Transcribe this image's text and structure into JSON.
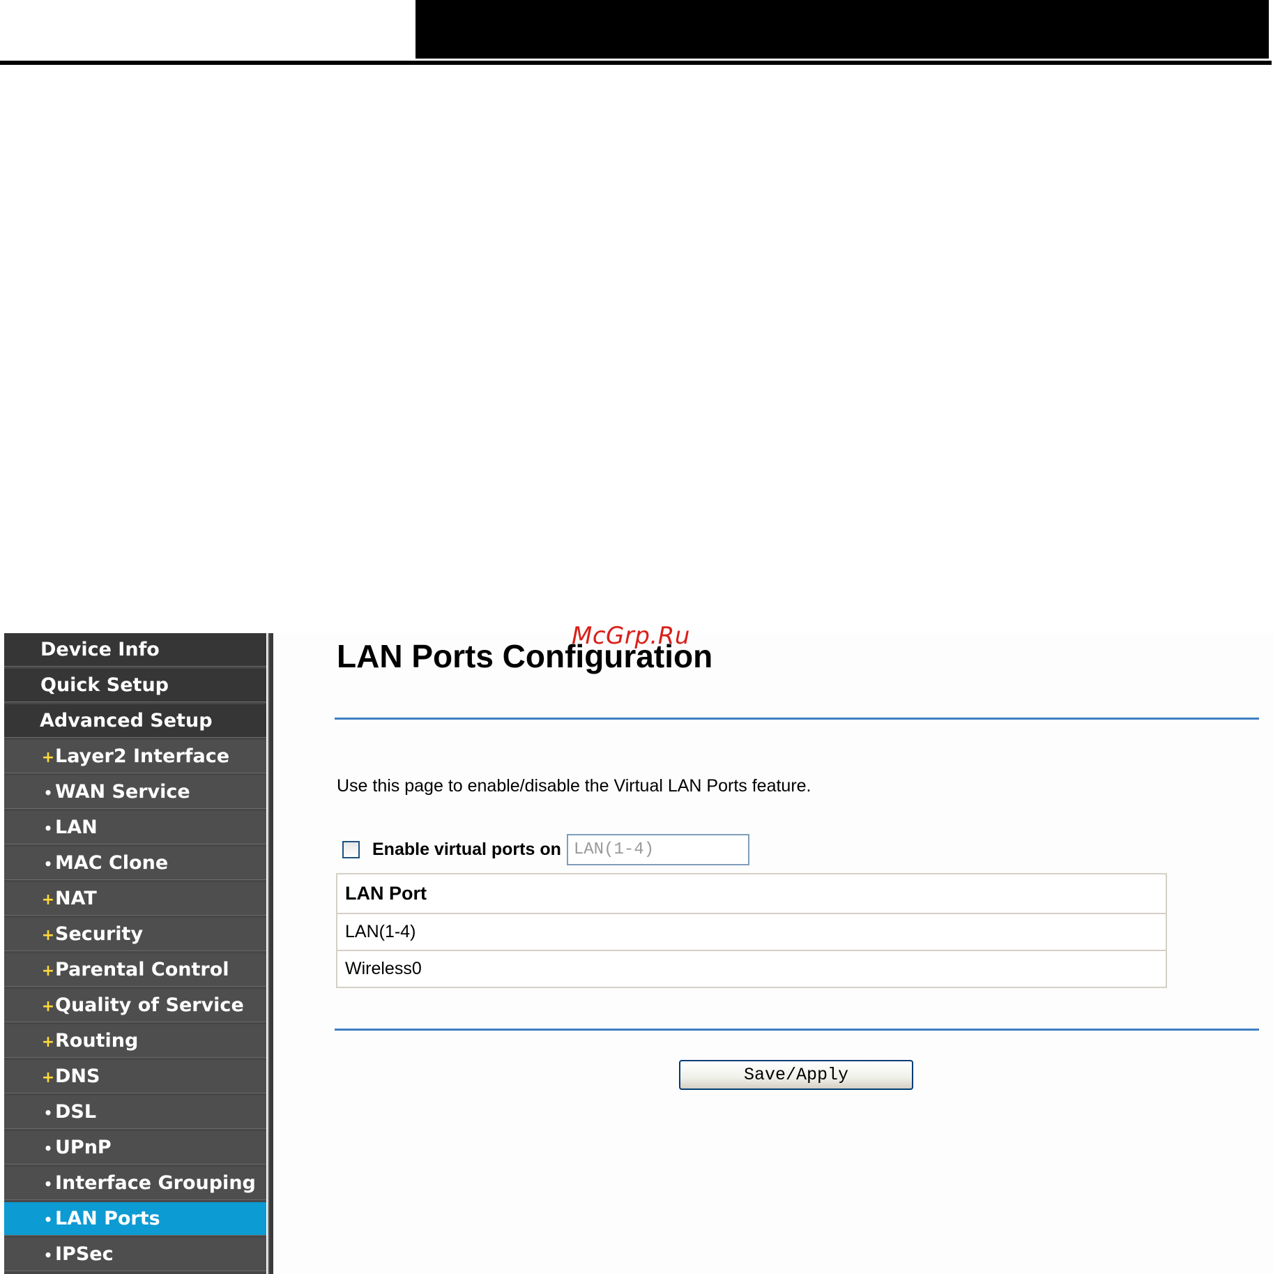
{
  "watermark": "McGrp.Ru",
  "sidebar": {
    "items": [
      {
        "label": "Device Info",
        "bullet": ""
      },
      {
        "label": "Quick Setup",
        "bullet": ""
      },
      {
        "label": "Advanced Setup",
        "bullet": ""
      },
      {
        "label": "Layer2 Interface",
        "bullet": "+"
      },
      {
        "label": "WAN Service",
        "bullet": "•"
      },
      {
        "label": "LAN",
        "bullet": "•"
      },
      {
        "label": "MAC Clone",
        "bullet": "•"
      },
      {
        "label": "NAT",
        "bullet": "+"
      },
      {
        "label": "Security",
        "bullet": "+"
      },
      {
        "label": "Parental Control",
        "bullet": "+"
      },
      {
        "label": "Quality of Service",
        "bullet": "+"
      },
      {
        "label": "Routing",
        "bullet": "+"
      },
      {
        "label": "DNS",
        "bullet": "+"
      },
      {
        "label": "DSL",
        "bullet": "•"
      },
      {
        "label": "UPnP",
        "bullet": "•"
      },
      {
        "label": "Interface Grouping",
        "bullet": "•"
      },
      {
        "label": "LAN Ports",
        "bullet": "•"
      },
      {
        "label": "IPSec",
        "bullet": "•"
      }
    ],
    "active": "LAN Ports"
  },
  "main": {
    "title": "LAN Ports Configuration",
    "description": "Use this page to enable/disable the Virtual LAN Ports feature.",
    "enable_label": "Enable virtual ports on",
    "enable_checked": false,
    "port_input_value": "LAN(1-4)",
    "table": {
      "header": "LAN Port",
      "rows": [
        "LAN(1-4)",
        "Wireless0"
      ]
    },
    "save_label": "Save/Apply"
  },
  "colors": {
    "sidebar_bg": "#474747",
    "active_item": "#0c9bd3",
    "rule": "#3d7fc1",
    "watermark": "#d9201a"
  }
}
